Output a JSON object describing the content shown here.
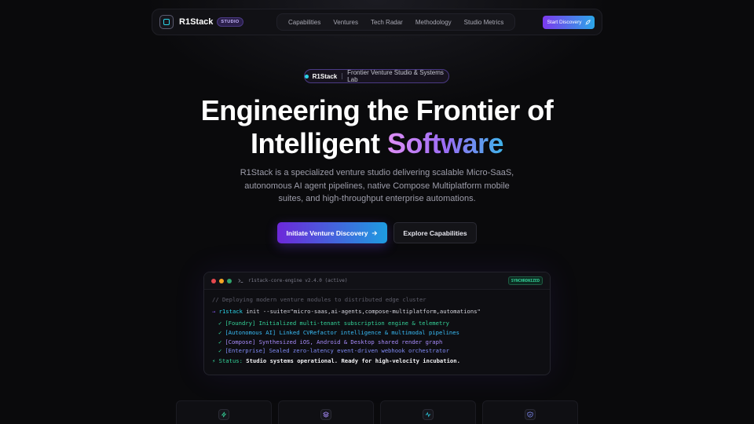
{
  "nav": {
    "brand_primary": "R1",
    "brand_secondary": "Stack",
    "studio_badge": "STUDIO",
    "links": [
      "Capabilities",
      "Ventures",
      "Tech Radar",
      "Methodology",
      "Studio Metrics"
    ],
    "cta_label": "Start Discovery"
  },
  "pill": {
    "brand": "R1Stack",
    "text": "Frontier Venture Studio & Systems Lab"
  },
  "hero": {
    "title_line1": "Engineering the Frontier of",
    "title_line2_plain": "Intelligent ",
    "title_line2_gradient": "Software",
    "subtitle": "R1Stack is a specialized venture studio delivering scalable Micro-SaaS, autonomous AI agent pipelines, native Compose Multiplatform mobile suites, and high-throughput enterprise automations.",
    "primary_cta": "Initiate Venture Discovery",
    "secondary_cta": "Explore Capabilities"
  },
  "terminal": {
    "title": "r1stack-core-engine v2.4.0 (active)",
    "sync_badge": "SYNCHRONIZED",
    "comment": "// Deploying modern venture modules to distributed edge cluster",
    "prompt": "→",
    "cmd_keyword": "r1stack",
    "cmd_rest": " init --suite=\"micro-saas,ai-agents,compose-multiplatform,automations\"",
    "lines": [
      "[Foundry] Initialized multi-tenant subscription engine & telemetry",
      "[Autonomous AI] Linked CVRefactor intelligence & multimodal pipelines",
      "[Compose] Synthesized iOS, Android & Desktop shared render graph",
      "[Enterprise] Sealed zero-latency event-driven webhook orchestrator"
    ],
    "status_label": "⚡ Status:",
    "status_text": "Studio systems operational. Ready for high-velocity incubation."
  },
  "cards": [
    {
      "icon": "bolt-icon"
    },
    {
      "icon": "layers-icon"
    },
    {
      "icon": "activity-icon"
    },
    {
      "icon": "shield-icon"
    }
  ],
  "colors": {
    "background": "#0a0a0c",
    "accent_purple": "#7c3aed",
    "accent_cyan": "#2bd3e8",
    "success": "#34d399"
  }
}
